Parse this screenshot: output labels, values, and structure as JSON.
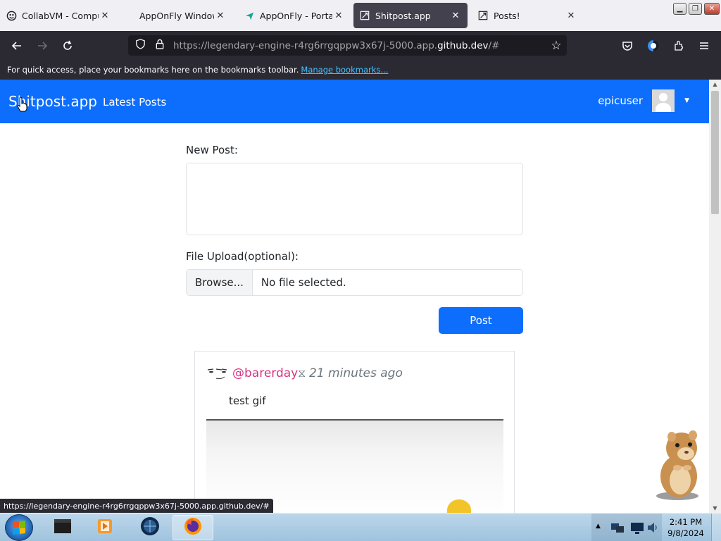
{
  "browser": {
    "tabs": [
      {
        "label": "CollabVM - Comput",
        "icon": "collabvm-icon",
        "active": false
      },
      {
        "label": "AppOnFly Windows",
        "icon": "none",
        "active": false
      },
      {
        "label": "AppOnFly - Portal",
        "icon": "paper-plane-icon",
        "active": false
      },
      {
        "label": "Shitpost.app",
        "icon": "site-icon",
        "active": true
      },
      {
        "label": "Posts!",
        "icon": "site-icon",
        "active": false
      }
    ],
    "url_prefix": "https://legendary-engine-r4rg6rrgqppw3x67j-5000.app.",
    "url_domain": "github.dev",
    "url_suffix": "/#",
    "bookmarks_text": "For quick access, place your bookmarks here on the bookmarks toolbar.",
    "bookmarks_link": "Manage bookmarks...",
    "status_url": "https://legendary-engine-r4rg6rrgqppw3x67j-5000.app.github.dev/#"
  },
  "site": {
    "brand": "Shitpost.app",
    "nav_link": "Latest Posts",
    "username": "epicuser"
  },
  "form": {
    "new_post_label": "New Post:",
    "new_post_value": "",
    "file_label": "File Upload(optional):",
    "browse_label": "Browse...",
    "file_status": "No file selected.",
    "post_button": "Post"
  },
  "post": {
    "handle": "@barerday",
    "time": "21 minutes ago",
    "text": "test gif"
  },
  "taskbar": {
    "time": "2:41 PM",
    "date": "9/8/2024"
  },
  "colors": {
    "primary": "#0d6efd",
    "handle": "#d63384",
    "browser_dark": "#2b2a33"
  }
}
